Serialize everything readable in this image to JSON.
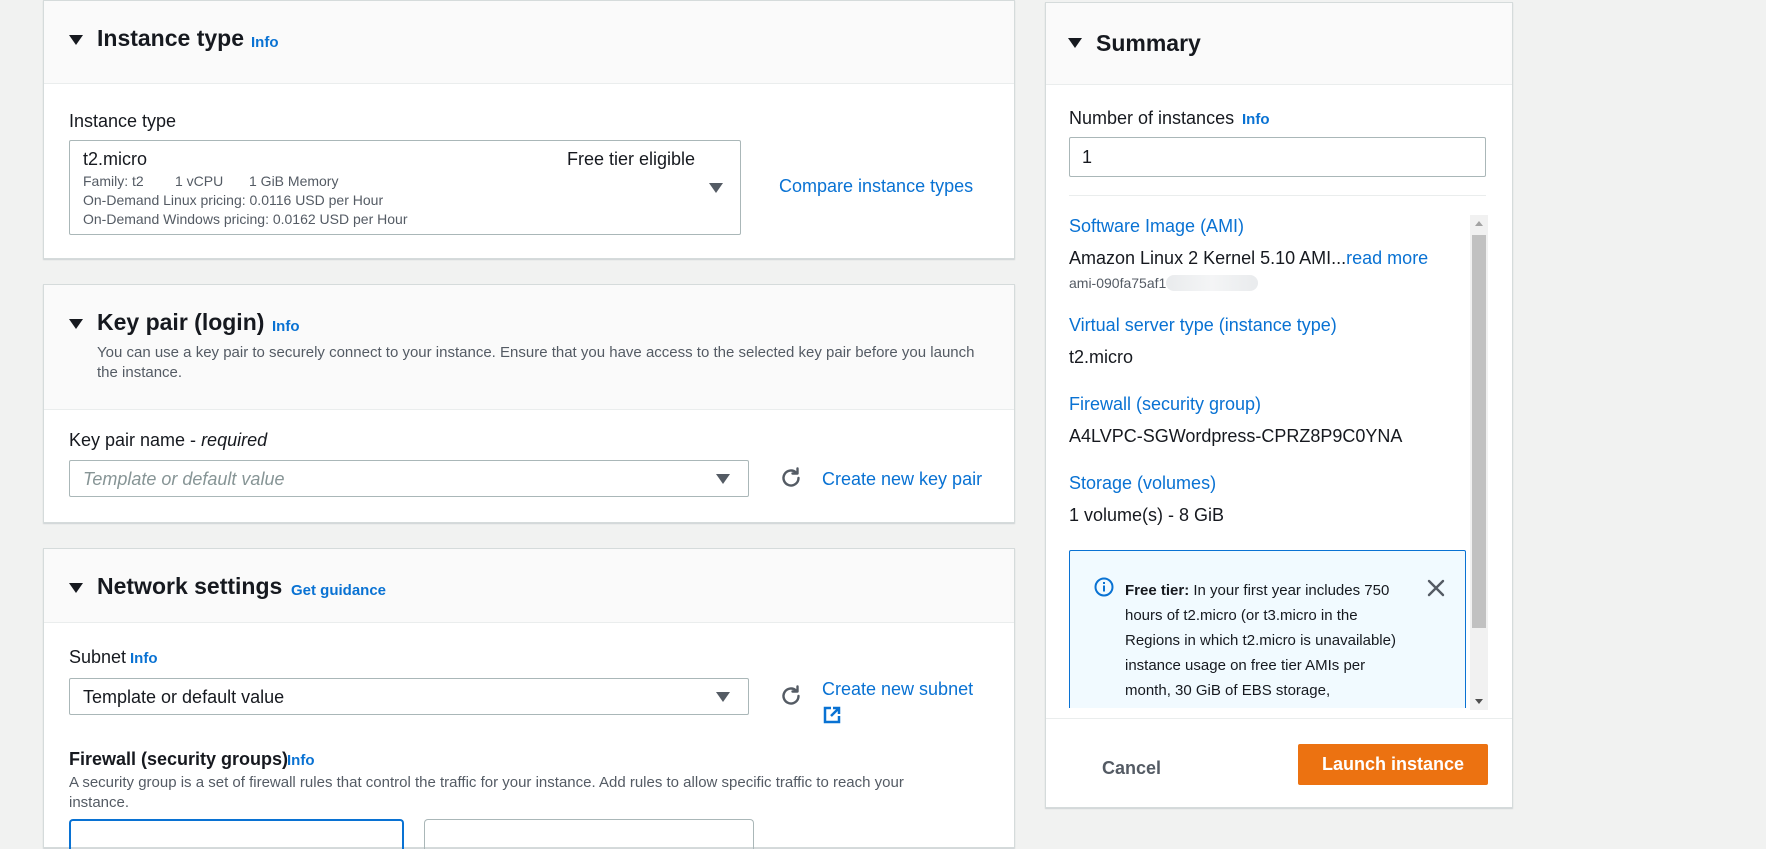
{
  "instance_type": {
    "title": "Instance type",
    "info": "Info",
    "field_label": "Instance type",
    "selected": {
      "name": "t2.micro",
      "badge": "Free tier eligible",
      "family": "Family: t2",
      "vcpu": "1 vCPU",
      "memory": "1 GiB Memory",
      "linux_pricing": "On-Demand Linux pricing: 0.0116 USD per Hour",
      "windows_pricing": "On-Demand Windows pricing: 0.0162 USD per Hour"
    },
    "compare_link": "Compare instance types"
  },
  "key_pair": {
    "title": "Key pair (login)",
    "info": "Info",
    "description": "You can use a key pair to securely connect to your instance. Ensure that you have access to the selected key pair before you launch the instance.",
    "field_label": "Key pair name - ",
    "field_required": "required",
    "placeholder": "Template or default value",
    "create_link": "Create new key pair"
  },
  "network": {
    "title": "Network settings",
    "guidance": "Get guidance",
    "subnet_label": "Subnet",
    "subnet_info": "Info",
    "subnet_value": "Template or default value",
    "create_subnet_link": "Create new subnet",
    "firewall_label": "Firewall (security groups)",
    "firewall_info": "Info",
    "firewall_description": "A security group is a set of firewall rules that control the traffic for your instance. Add rules to allow specific traffic to reach your instance."
  },
  "summary": {
    "title": "Summary",
    "instances_label": "Number of instances",
    "instances_info": "Info",
    "instances_value": "1",
    "ami_key": "Software Image (AMI)",
    "ami_value": "Amazon Linux 2 Kernel 5.10 AMI...",
    "ami_read_more": "read more",
    "ami_id": "ami-090fa75af1",
    "server_type_key": "Virtual server type (instance type)",
    "server_type_value": "t2.micro",
    "firewall_key": "Firewall (security group)",
    "firewall_value": "A4LVPC-SGWordpress-CPRZ8P9C0YNA",
    "storage_key": "Storage (volumes)",
    "storage_value": "1 volume(s) - 8 GiB",
    "free_tier_title": "Free tier:",
    "free_tier_text": "In your first year includes 750 hours of t2.micro (or t3.micro in the Regions in which t2.micro is unavailable) instance usage on free tier AMIs per month, 30 GiB of EBS storage,",
    "cancel_label": "Cancel",
    "launch_label": "Launch instance"
  },
  "colors": {
    "link": "#0972d3",
    "primary_button": "#ec7211",
    "info_box_border": "#0972d3",
    "info_box_bg": "#f1faff"
  }
}
